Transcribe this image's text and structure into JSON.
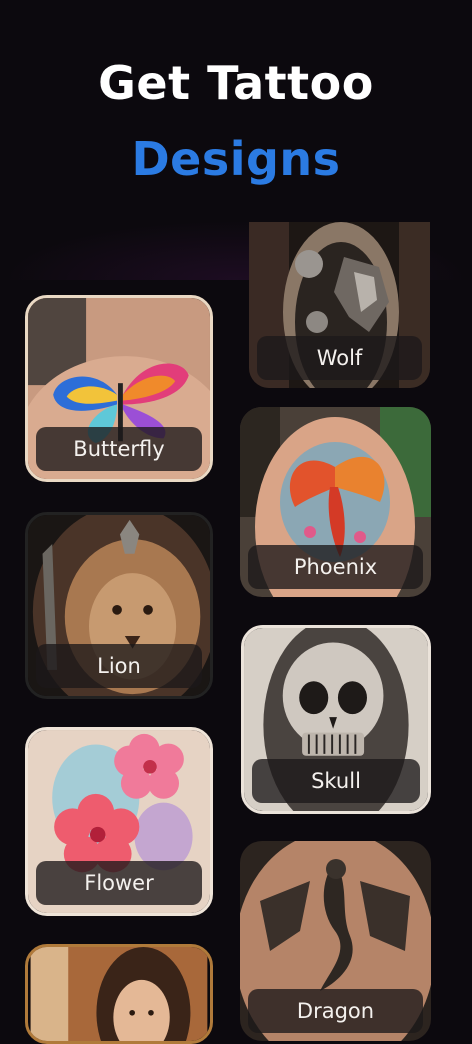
{
  "header": {
    "title_line1": "Get Tattoo",
    "title_line2": "Designs"
  },
  "colors": {
    "background": "#0c090e",
    "title_white": "#ffffff",
    "title_accent": "#2b7be3",
    "card_border": "#ead9c4"
  },
  "designs": [
    {
      "label": "Butterfly",
      "column": "left"
    },
    {
      "label": "Wolf",
      "column": "right"
    },
    {
      "label": "Phoenix",
      "column": "right"
    },
    {
      "label": "Lion",
      "column": "left"
    },
    {
      "label": "Skull",
      "column": "right"
    },
    {
      "label": "Flower",
      "column": "left"
    },
    {
      "label": "Dragon",
      "column": "right"
    },
    {
      "label": "",
      "column": "left"
    }
  ]
}
